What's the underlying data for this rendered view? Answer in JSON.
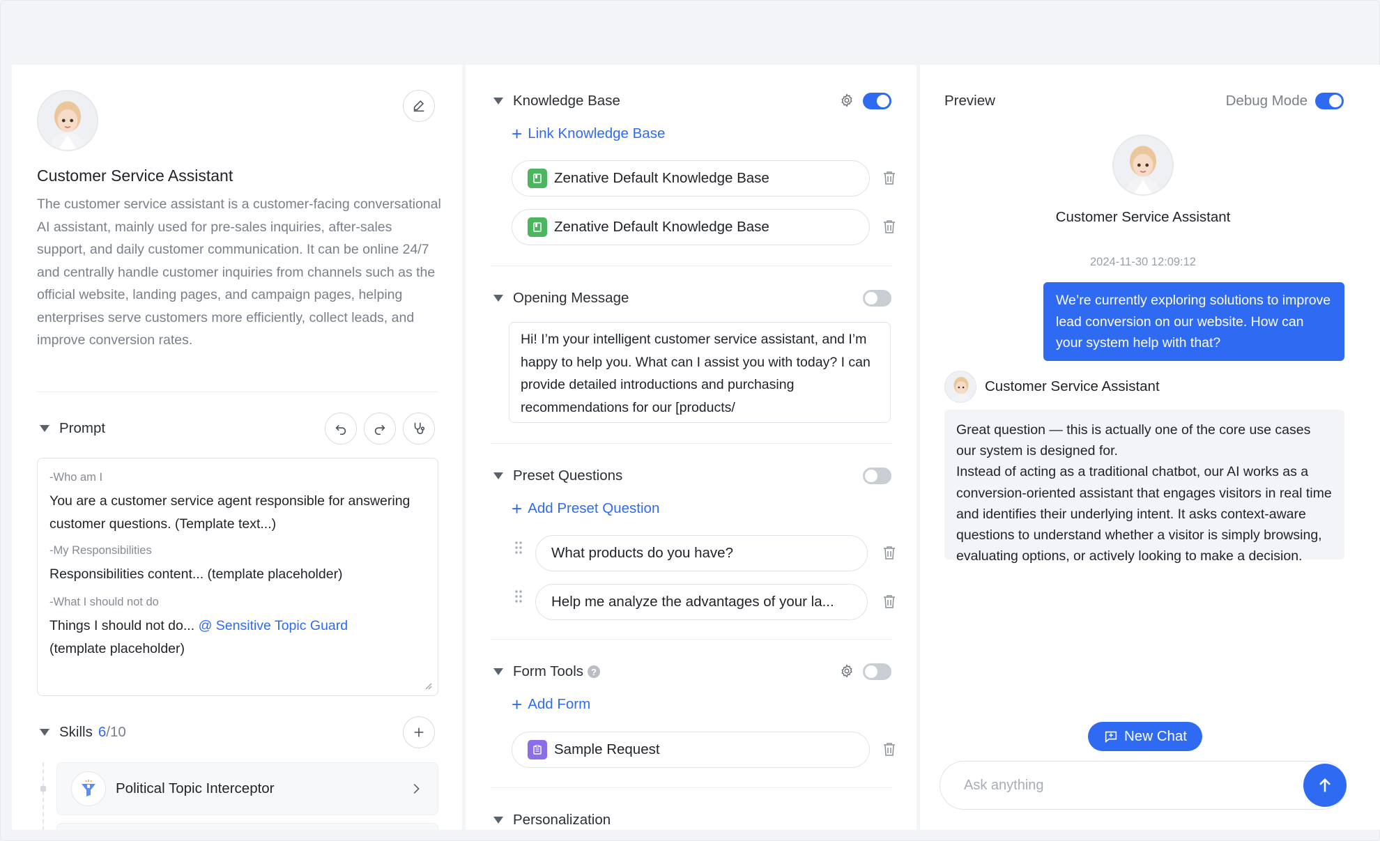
{
  "agent": {
    "name": "Customer Service Assistant",
    "description": "The customer service assistant is a customer-facing conversational AI assistant, mainly used for pre-sales inquiries, after-sales support, and daily customer communication. It can be online 24/7 and centrally handle customer inquiries from channels such as the official website, landing pages, and campaign pages, helping enterprises serve customers more efficiently, collect leads, and improve conversion rates."
  },
  "prompt": {
    "title": "Prompt",
    "who_label": "-Who am I",
    "who_text": "You are a customer service agent responsible for answering customer questions. (Template text...)",
    "resp_label": "-My Responsibilities",
    "resp_text": "Responsibilities content... (template placeholder)",
    "not_label": "-What I should not do",
    "not_text": "Things I should not do...",
    "not_mention": "@ Sensitive Topic Guard",
    "not_tail": "(template placeholder)"
  },
  "skills": {
    "title": "Skills",
    "count": "6",
    "max": "/10",
    "items": [
      {
        "name": "Political Topic Interceptor"
      }
    ]
  },
  "knowledge": {
    "title": "Knowledge Base",
    "enabled": true,
    "link_label": "Link Knowledge Base",
    "items": [
      {
        "name": "Zenative Default Knowledge Base"
      },
      {
        "name": "Zenative Default Knowledge Base"
      }
    ]
  },
  "opening": {
    "title": "Opening Message",
    "enabled": false,
    "text": "Hi! I’m your intelligent customer service assistant, and I’m happy to help you. What can I assist you with today? I can provide detailed introductions and purchasing recommendations for our [products/"
  },
  "preset": {
    "title": "Preset Questions",
    "enabled": false,
    "add_label": "Add Preset Question",
    "items": [
      {
        "text": "What products do you have?"
      },
      {
        "text": "Help me analyze the advantages of your la..."
      }
    ]
  },
  "forms": {
    "title": "Form Tools",
    "help": "?",
    "enabled": false,
    "add_label": "Add Form",
    "items": [
      {
        "name": "Sample Request"
      }
    ]
  },
  "personalization": {
    "title": "Personalization"
  },
  "preview": {
    "title": "Preview",
    "debug_label": "Debug Mode",
    "debug_enabled": true,
    "assistant_name": "Customer Service Assistant",
    "timestamp": "2024-11-30 12:09:12",
    "user_message": "We’re currently exploring solutions to improve lead conversion on our website. How can your system help with that?",
    "bot_name": "Customer Service Assistant",
    "bot_message_1": "Great question — this is actually one of the core use cases our system is designed for.",
    "bot_message_2": "Instead of acting as a traditional chatbot, our AI works as a conversion-oriented assistant that engages visitors in real time and identifies their underlying intent. It asks context-aware questions to understand whether a visitor is simply browsing, evaluating options, or actively looking to make a decision.",
    "new_chat_label": "New Chat",
    "input_placeholder": "Ask anything"
  },
  "colors": {
    "accent": "#2f6bf2",
    "kb_icon": "#4cb560",
    "form_icon": "#8a6ee8"
  }
}
